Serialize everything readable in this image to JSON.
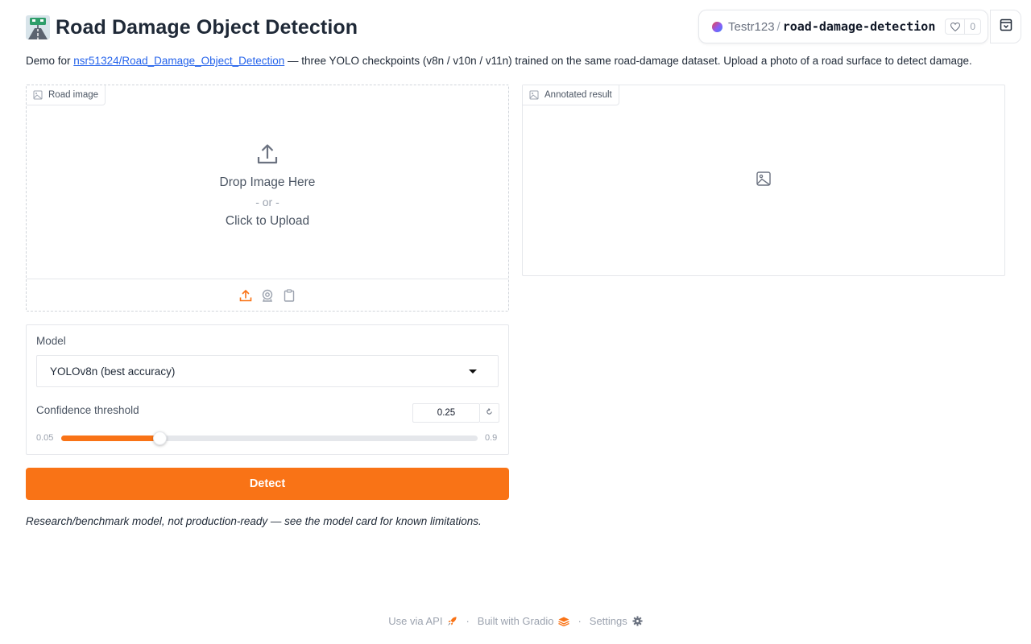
{
  "header": {
    "title": "Road Damage Object Detection",
    "title_icon": "motorway-emoji"
  },
  "space": {
    "owner": "Testr123",
    "separator": "/",
    "name": "road-damage-detection",
    "likes": "0"
  },
  "description": {
    "prefix": "Demo for",
    "link_text": "nsr51324/Road_Damage_Object_Detection",
    "suffix": "— three YOLO checkpoints (v8n / v10n / v11n) trained on the same road-damage dataset. Upload a photo of a road surface to detect damage."
  },
  "input_image": {
    "label": "Road image",
    "drop_text": "Drop Image Here",
    "or_text": "- or -",
    "click_text": "Click to Upload",
    "sources": [
      "upload-icon",
      "webcam-icon",
      "clipboard-icon"
    ]
  },
  "output_image": {
    "label": "Annotated result"
  },
  "model": {
    "label": "Model",
    "selected": "YOLOv8n (best accuracy)"
  },
  "confidence": {
    "label": "Confidence threshold",
    "value": "0.25",
    "min": "0.05",
    "max": "0.9",
    "fraction": 0.2353
  },
  "detect_button": "Detect",
  "disclaimer": "Research/benchmark model, not production-ready — see the model card for known limitations.",
  "footer": {
    "api": "Use via API",
    "built": "Built with Gradio",
    "settings": "Settings",
    "separator": "·"
  },
  "colors": {
    "accent": "#f97316",
    "link": "#2563eb"
  }
}
